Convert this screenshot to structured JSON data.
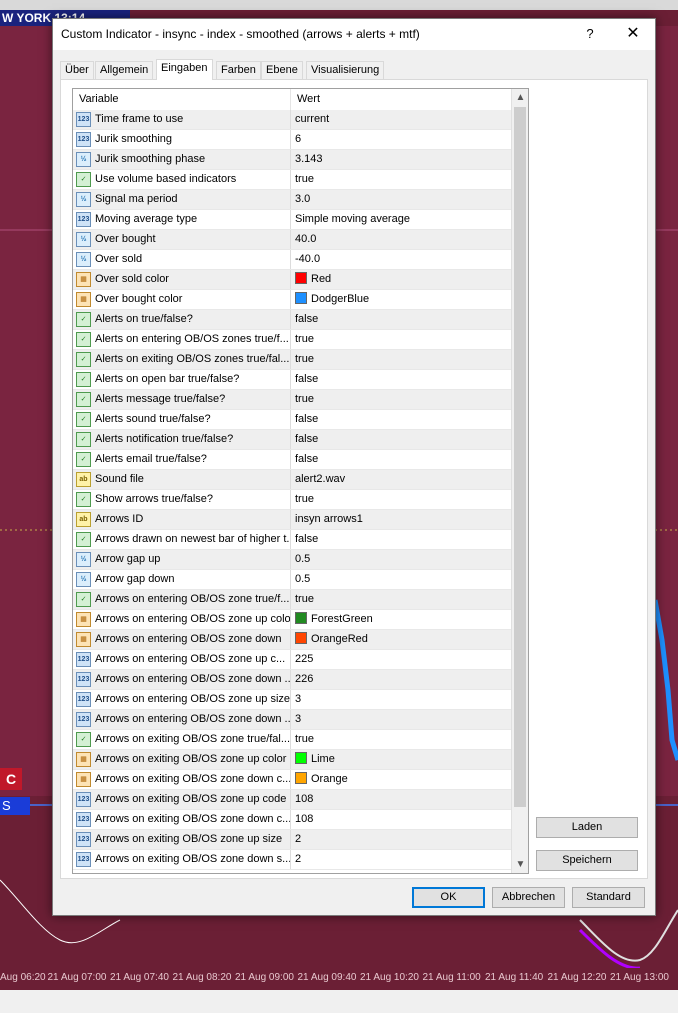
{
  "background": {
    "title": "W YORK  13:14",
    "time_labels": [
      "Aug 06:20",
      "21 Aug 07:00",
      "21 Aug 07:40",
      "21 Aug 08:20",
      "21 Aug 09:00",
      "21 Aug 09:40",
      "21 Aug 10:20",
      "21 Aug 11:00",
      "21 Aug 11:40",
      "21 Aug 12:20",
      "21 Aug 13:00"
    ],
    "side_label": "C",
    "side_label2": "S"
  },
  "dialog": {
    "title": "Custom Indicator - insync - index - smoothed (arrows + alerts + mtf)",
    "help_glyph": "?",
    "close_glyph": "✕",
    "tabs": [
      "Über",
      "Allgemein",
      "Eingaben",
      "Farben",
      "Ebene",
      "Visualisierung"
    ],
    "active_tab": "Eingaben",
    "grid": {
      "col_variable": "Variable",
      "col_value": "Wert",
      "rows": [
        {
          "icon": "int",
          "variable": "Time frame to use",
          "value": "current"
        },
        {
          "icon": "int",
          "variable": "Jurik smoothing",
          "value": "6"
        },
        {
          "icon": "dbl",
          "variable": "Jurik smoothing phase",
          "value": "3.143"
        },
        {
          "icon": "bool",
          "variable": "Use volume based indicators",
          "value": "true"
        },
        {
          "icon": "dbl",
          "variable": "Signal ma period",
          "value": "3.0"
        },
        {
          "icon": "int",
          "variable": "Moving average type",
          "value": "Simple moving average"
        },
        {
          "icon": "dbl",
          "variable": "Over bought",
          "value": "40.0"
        },
        {
          "icon": "dbl",
          "variable": "Over sold",
          "value": "-40.0"
        },
        {
          "icon": "color",
          "variable": "Over sold color",
          "value": "Red",
          "swatch": "#ff0000"
        },
        {
          "icon": "color",
          "variable": "Over bought color",
          "value": "DodgerBlue",
          "swatch": "#1e90ff"
        },
        {
          "icon": "bool",
          "variable": "Alerts on true/false?",
          "value": "false"
        },
        {
          "icon": "bool",
          "variable": "Alerts on entering OB/OS zones true/f...",
          "value": "true"
        },
        {
          "icon": "bool",
          "variable": "Alerts on exiting OB/OS zones true/fal...",
          "value": "true"
        },
        {
          "icon": "bool",
          "variable": "Alerts on open bar true/false?",
          "value": "false"
        },
        {
          "icon": "bool",
          "variable": "Alerts message true/false?",
          "value": "true"
        },
        {
          "icon": "bool",
          "variable": "Alerts sound true/false?",
          "value": "false"
        },
        {
          "icon": "bool",
          "variable": "Alerts notification true/false?",
          "value": "false"
        },
        {
          "icon": "bool",
          "variable": "Alerts email true/false?",
          "value": "false"
        },
        {
          "icon": "str",
          "variable": "Sound file",
          "value": "alert2.wav"
        },
        {
          "icon": "bool",
          "variable": "Show arrows true/false?",
          "value": "true"
        },
        {
          "icon": "str",
          "variable": "Arrows ID",
          "value": "insyn arrows1"
        },
        {
          "icon": "bool",
          "variable": "Arrows drawn on newest bar of higher t...",
          "value": "false"
        },
        {
          "icon": "dbl",
          "variable": "Arrow gap up",
          "value": "0.5"
        },
        {
          "icon": "dbl",
          "variable": "Arrow gap down",
          "value": "0.5"
        },
        {
          "icon": "bool",
          "variable": "Arrows on entering OB/OS zone true/f...",
          "value": "true"
        },
        {
          "icon": "color",
          "variable": "Arrows on entering OB/OS zone up color",
          "value": "ForestGreen",
          "swatch": "#228b22"
        },
        {
          "icon": "color",
          "variable": "Arrows on entering OB/OS zone down",
          "value": "OrangeRed",
          "swatch": "#ff4500"
        },
        {
          "icon": "int",
          "variable": "Arrows on entering OB/OS zone up c...",
          "value": "225"
        },
        {
          "icon": "int",
          "variable": "Arrows on entering OB/OS zone down ...",
          "value": "226"
        },
        {
          "icon": "int",
          "variable": "Arrows on entering OB/OS zone up size",
          "value": "3"
        },
        {
          "icon": "int",
          "variable": "Arrows on entering OB/OS zone down ...",
          "value": "3"
        },
        {
          "icon": "bool",
          "variable": "Arrows on exiting OB/OS zone true/fal...",
          "value": "true"
        },
        {
          "icon": "color",
          "variable": "Arrows on exiting OB/OS zone up color",
          "value": "Lime",
          "swatch": "#00ff00"
        },
        {
          "icon": "color",
          "variable": "Arrows on exiting OB/OS zone down c...",
          "value": "Orange",
          "swatch": "#ffa500"
        },
        {
          "icon": "int",
          "variable": "Arrows on exiting OB/OS zone up code",
          "value": "108"
        },
        {
          "icon": "int",
          "variable": "Arrows on exiting OB/OS zone down c...",
          "value": "108"
        },
        {
          "icon": "int",
          "variable": "Arrows on exiting OB/OS zone up size",
          "value": "2"
        },
        {
          "icon": "int",
          "variable": "Arrows on exiting OB/OS zone down s...",
          "value": "2"
        }
      ]
    },
    "buttons": {
      "load": "Laden",
      "save": "Speichern",
      "ok": "OK",
      "cancel": "Abbrechen",
      "reset": "Standard"
    }
  },
  "icon_labels": {
    "int": "123",
    "dbl": "½",
    "bool": "✓",
    "color": "▦",
    "str": "ab"
  }
}
